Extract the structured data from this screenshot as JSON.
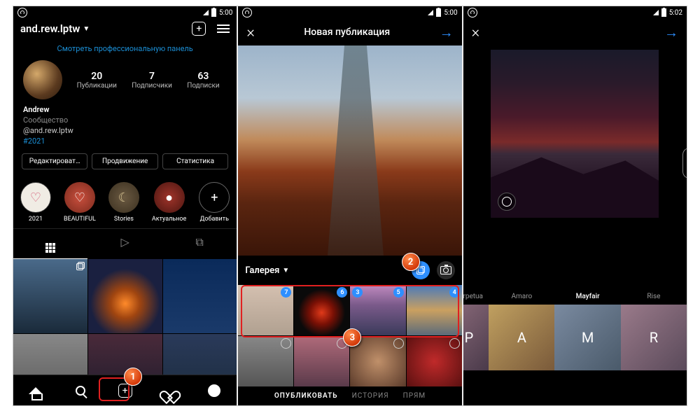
{
  "status": {
    "time1": "5:00",
    "time2": "5:00",
    "time3": "5:02"
  },
  "screen1": {
    "username": "and.rew.lptw",
    "pro_link": "Смотреть профессиональную панель",
    "stats": {
      "posts_n": "20",
      "posts_l": "Публикации",
      "followers_n": "7",
      "followers_l": "Подписчики",
      "following_n": "63",
      "following_l": "Подписки"
    },
    "bio": {
      "name": "Andrew",
      "sub": "Сообщество",
      "at": "@and.rew.lptw",
      "tag": "#2021"
    },
    "buttons": {
      "edit": "Редактироват…",
      "promote": "Продвижение",
      "stats": "Статистика"
    },
    "stories": {
      "s1": "2021",
      "s2": "BEAUTIFUL",
      "s3": "Stories",
      "s4": "Актуальное",
      "s5": "Добавить"
    }
  },
  "screen2": {
    "title": "Новая публикация",
    "gallery": "Галерея",
    "badges": {
      "b1": "7",
      "b2": "6",
      "b3": "5",
      "b4": "3",
      "b5": "4"
    },
    "modes": {
      "pub": "ОПУБЛИКОВАТЬ",
      "story": "ИСТОРИЯ",
      "live": "ПРЯМ"
    }
  },
  "screen3": {
    "filters": {
      "f0": "Perpetua",
      "f1": "Amaro",
      "f2": "Mayfair",
      "f3": "Rise"
    },
    "letters": {
      "l0": "P",
      "l1": "A",
      "l2": "M",
      "l3": "R"
    }
  },
  "annot": {
    "a1": "1",
    "a2": "2",
    "a3": "3"
  }
}
